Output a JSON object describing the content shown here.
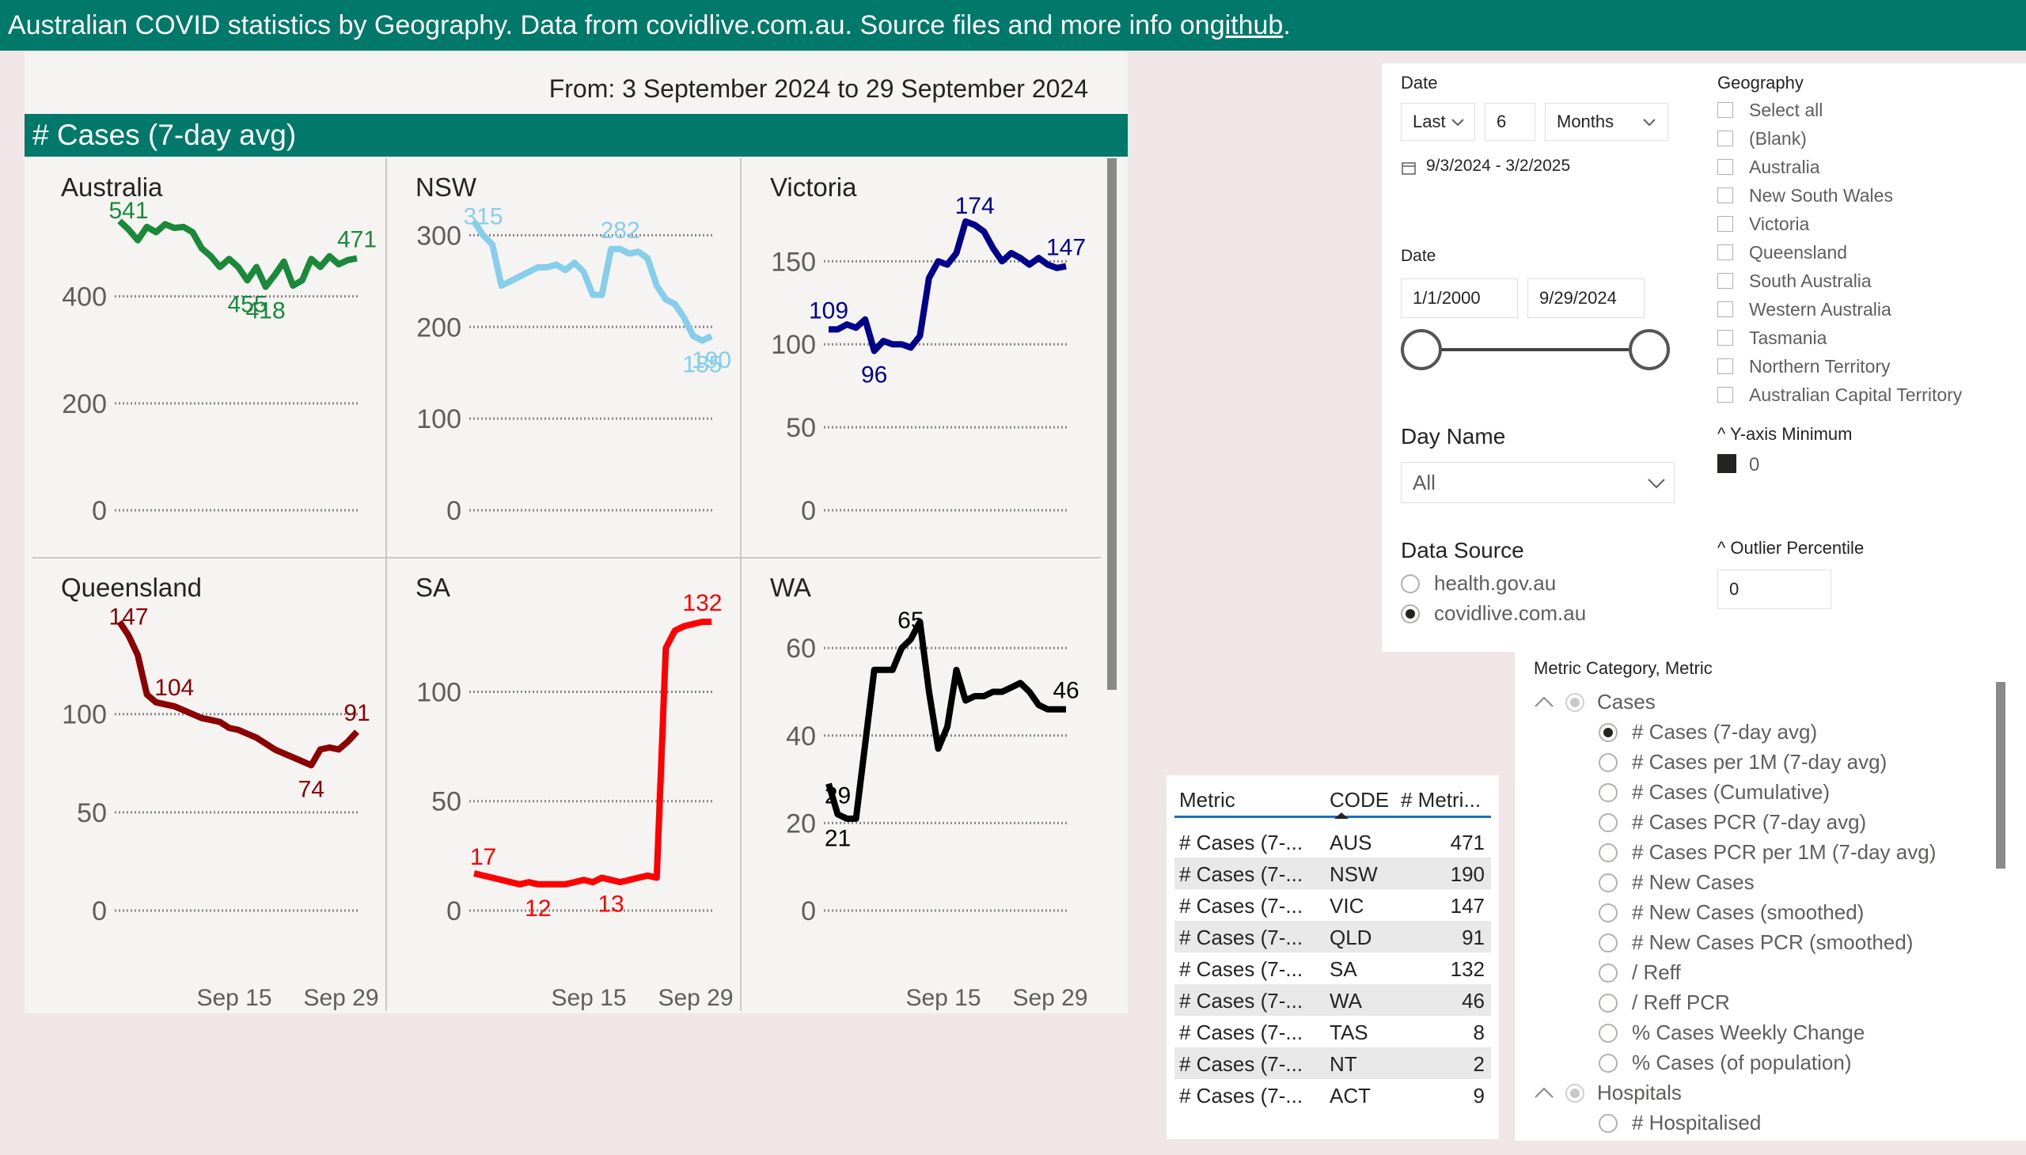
{
  "header": {
    "text": "Australian COVID statistics by Geography. Data from covidlive.com.au. Source files and more info on ",
    "link": "github",
    "suffix": "."
  },
  "chart_panel": {
    "date_range": "From: 3 September 2024 to 29 September 2024",
    "title": "# Cases (7-day avg)"
  },
  "chart_data": [
    {
      "type": "line",
      "title": "Australia",
      "color": "#1a8a3a",
      "ylim": [
        0,
        540
      ],
      "yticks": [
        0,
        200,
        400
      ],
      "x": [
        0,
        1,
        2,
        3,
        4,
        5,
        6,
        7,
        8,
        9,
        10,
        11,
        12,
        13,
        14,
        15,
        16,
        17,
        18,
        19,
        20,
        21,
        22,
        23,
        24,
        25,
        26
      ],
      "values": [
        541,
        525,
        505,
        530,
        520,
        535,
        528,
        530,
        520,
        490,
        475,
        455,
        470,
        455,
        430,
        455,
        418,
        440,
        465,
        420,
        430,
        470,
        455,
        475,
        460,
        468,
        471
      ],
      "labels": [
        {
          "i": 1,
          "text": "541"
        },
        {
          "i": 14,
          "text": "455"
        },
        {
          "i": 16,
          "text": "418"
        },
        {
          "i": 26,
          "text": "471"
        }
      ],
      "xticks": [
        "Sep 15",
        "Sep 29"
      ]
    },
    {
      "type": "line",
      "title": "NSW",
      "color": "#87ceeb",
      "ylim": [
        0,
        315
      ],
      "yticks": [
        0,
        100,
        200,
        300
      ],
      "x": [
        0,
        1,
        2,
        3,
        4,
        5,
        6,
        7,
        8,
        9,
        10,
        11,
        12,
        13,
        14,
        15,
        16,
        17,
        18,
        19,
        20,
        21,
        22,
        23,
        24,
        25,
        26
      ],
      "values": [
        315,
        300,
        290,
        245,
        250,
        255,
        260,
        265,
        265,
        268,
        262,
        270,
        260,
        235,
        235,
        285,
        285,
        280,
        282,
        275,
        245,
        230,
        225,
        210,
        190,
        185,
        190
      ],
      "labels": [
        {
          "i": 1,
          "text": "315"
        },
        {
          "i": 16,
          "text": "282"
        },
        {
          "i": 26,
          "text": "190"
        },
        {
          "i": 25,
          "text": "185"
        }
      ],
      "xticks": [
        "Sep 15",
        "Sep 29"
      ]
    },
    {
      "type": "line",
      "title": "Victoria",
      "color": "#00008b",
      "ylim": [
        0,
        174
      ],
      "yticks": [
        0,
        50,
        100,
        150
      ],
      "x": [
        0,
        1,
        2,
        3,
        4,
        5,
        6,
        7,
        8,
        9,
        10,
        11,
        12,
        13,
        14,
        15,
        16,
        17,
        18,
        19,
        20,
        21,
        22,
        23,
        24,
        25,
        26
      ],
      "values": [
        109,
        109,
        112,
        110,
        115,
        96,
        102,
        100,
        100,
        98,
        105,
        140,
        150,
        148,
        155,
        174,
        172,
        168,
        158,
        150,
        155,
        152,
        148,
        152,
        148,
        146,
        147
      ],
      "labels": [
        {
          "i": 0,
          "text": "109"
        },
        {
          "i": 5,
          "text": "96"
        },
        {
          "i": 16,
          "text": "174"
        },
        {
          "i": 26,
          "text": "147"
        }
      ],
      "xticks": [
        "Sep 15",
        "Sep 29"
      ]
    },
    {
      "type": "line",
      "title": "Queensland",
      "color": "#8b0000",
      "ylim": [
        0,
        147
      ],
      "yticks": [
        0,
        50,
        100
      ],
      "x": [
        0,
        1,
        2,
        3,
        4,
        5,
        6,
        7,
        8,
        9,
        10,
        11,
        12,
        13,
        14,
        15,
        16,
        17,
        18,
        19,
        20,
        21,
        22,
        23,
        24,
        25,
        26
      ],
      "values": [
        147,
        140,
        130,
        110,
        106,
        105,
        104,
        102,
        100,
        98,
        97,
        96,
        93,
        92,
        90,
        88,
        85,
        82,
        80,
        78,
        76,
        74,
        82,
        83,
        82,
        86,
        91
      ],
      "labels": [
        {
          "i": 1,
          "text": "147"
        },
        {
          "i": 6,
          "text": "104"
        },
        {
          "i": 21,
          "text": "74"
        },
        {
          "i": 26,
          "text": "91"
        }
      ],
      "xticks": [
        "Sep 15",
        "Sep 29"
      ]
    },
    {
      "type": "line",
      "title": "SA",
      "color": "#ff0000",
      "ylim": [
        0,
        132
      ],
      "yticks": [
        0,
        50,
        100
      ],
      "x": [
        0,
        1,
        2,
        3,
        4,
        5,
        6,
        7,
        8,
        9,
        10,
        11,
        12,
        13,
        14,
        15,
        16,
        17,
        18,
        19,
        20,
        21,
        22,
        23,
        24,
        25,
        26
      ],
      "values": [
        17,
        16,
        15,
        14,
        13,
        12,
        13,
        12,
        12,
        12,
        12,
        13,
        14,
        13,
        15,
        14,
        13,
        14,
        15,
        16,
        15,
        120,
        128,
        130,
        131,
        132,
        132
      ],
      "labels": [
        {
          "i": 1,
          "text": "17"
        },
        {
          "i": 7,
          "text": "12"
        },
        {
          "i": 15,
          "text": "13"
        },
        {
          "i": 25,
          "text": "132"
        }
      ],
      "xticks": [
        "Sep 15",
        "Sep 29"
      ]
    },
    {
      "type": "line",
      "title": "WA",
      "color": "#000000",
      "ylim": [
        0,
        66
      ],
      "yticks": [
        0,
        20,
        40,
        60
      ],
      "x": [
        0,
        1,
        2,
        3,
        4,
        5,
        6,
        7,
        8,
        9,
        10,
        11,
        12,
        13,
        14,
        15,
        16,
        17,
        18,
        19,
        20,
        21,
        22,
        23,
        24,
        25,
        26
      ],
      "values": [
        29,
        22,
        21,
        21,
        38,
        55,
        55,
        55,
        60,
        62,
        66,
        50,
        37,
        42,
        55,
        48,
        49,
        49,
        50,
        50,
        51,
        52,
        50,
        47,
        46,
        46,
        46
      ],
      "labels": [
        {
          "i": 1,
          "text": "29"
        },
        {
          "i": 1,
          "text": "21"
        },
        {
          "i": 9,
          "text": "65"
        },
        {
          "i": 26,
          "text": "46"
        }
      ],
      "xticks": [
        "Sep 15",
        "Sep 29"
      ]
    }
  ],
  "filters": {
    "date_label": "Date",
    "relative_mode": "Last",
    "relative_count": "6",
    "relative_unit": "Months",
    "relative_range": "9/3/2024 - 3/2/2025",
    "date2_label": "Date",
    "date_from": "1/1/2000",
    "date_to": "9/29/2024",
    "day_name_label": "Day Name",
    "day_name_value": "All",
    "data_source_label": "Data Source",
    "data_sources": [
      {
        "label": "health.gov.au",
        "selected": false
      },
      {
        "label": "covidlive.com.au",
        "selected": true
      }
    ],
    "geography_label": "Geography",
    "geographies": [
      "Select all",
      "(Blank)",
      "Australia",
      "New South Wales",
      "Victoria",
      "Queensland",
      "South Australia",
      "Western Australia",
      "Tasmania",
      "Northern Territory",
      "Australian Capital Territory"
    ],
    "ymin_label": "^ Y-axis Minimum",
    "ymin_value": "0",
    "outlier_label": "^ Outlier Percentile",
    "outlier_value": "0"
  },
  "table": {
    "headers": [
      "Metric",
      "CODE",
      "# Metri..."
    ],
    "rows": [
      {
        "metric": "# Cases (7-...",
        "code": "AUS",
        "value": "471"
      },
      {
        "metric": "# Cases (7-...",
        "code": "NSW",
        "value": "190"
      },
      {
        "metric": "# Cases (7-...",
        "code": "VIC",
        "value": "147"
      },
      {
        "metric": "# Cases (7-...",
        "code": "QLD",
        "value": "91"
      },
      {
        "metric": "# Cases (7-...",
        "code": "SA",
        "value": "132"
      },
      {
        "metric": "# Cases (7-...",
        "code": "WA",
        "value": "46"
      },
      {
        "metric": "# Cases (7-...",
        "code": "TAS",
        "value": "8"
      },
      {
        "metric": "# Cases (7-...",
        "code": "NT",
        "value": "2"
      },
      {
        "metric": "# Cases (7-...",
        "code": "ACT",
        "value": "9"
      }
    ]
  },
  "metric_slicer": {
    "title": "Metric Category, Metric",
    "category": "Cases",
    "items": [
      {
        "label": "# Cases (7-day avg)",
        "selected": true
      },
      {
        "label": "# Cases per 1M (7-day avg)",
        "selected": false
      },
      {
        "label": "# Cases (Cumulative)",
        "selected": false
      },
      {
        "label": "# Cases PCR (7-day avg)",
        "selected": false
      },
      {
        "label": "# Cases PCR per 1M (7-day avg)",
        "selected": false
      },
      {
        "label": "# New Cases",
        "selected": false
      },
      {
        "label": "# New Cases (smoothed)",
        "selected": false
      },
      {
        "label": "# New Cases PCR (smoothed)",
        "selected": false
      },
      {
        "label": "/ Reff",
        "selected": false
      },
      {
        "label": "/ Reff PCR",
        "selected": false
      },
      {
        "label": "% Cases Weekly Change",
        "selected": false
      },
      {
        "label": "% Cases (of population)",
        "selected": false
      }
    ],
    "category2": "Hospitals",
    "items2": [
      {
        "label": "# Hospitalised",
        "selected": false
      }
    ]
  }
}
